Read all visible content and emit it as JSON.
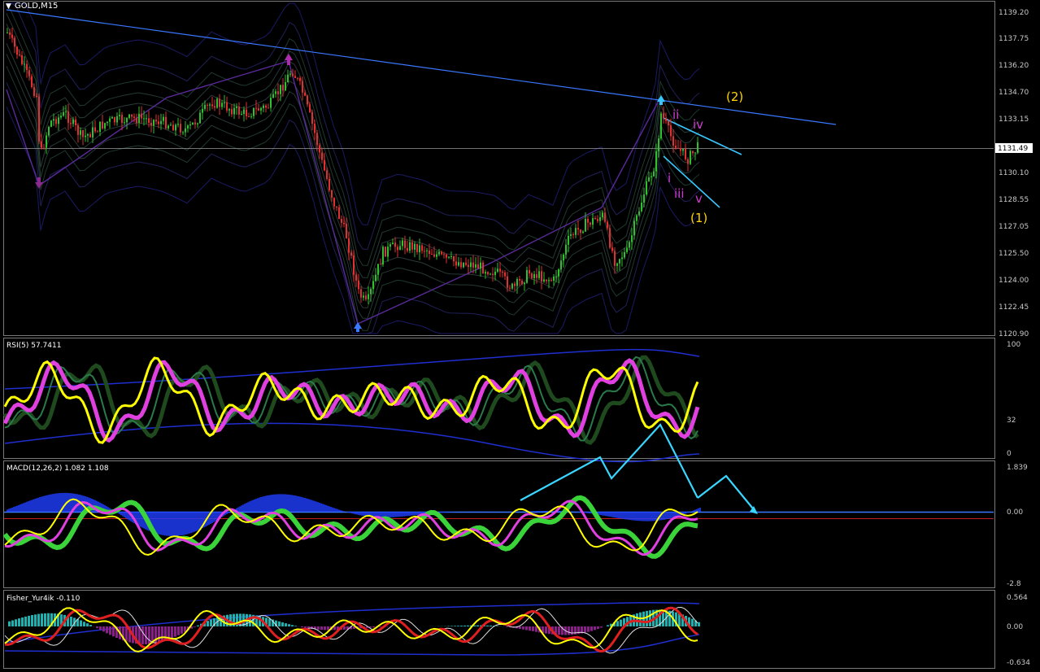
{
  "window": {
    "title": "GOLD,M15",
    "menu_glyph": "▼"
  },
  "colors": {
    "background": "#000000",
    "grid": "#2a2a2a",
    "axis_text": "#c8c8c8",
    "bull": "#2fbf2f",
    "bear": "#e03030",
    "trend": "#3a78ff",
    "channel": "#39c6ff",
    "wave_major": "#ffd400",
    "wave_minor": "#d23bd2",
    "rsi": "#ffff00",
    "rsi_glow": "#e040e0",
    "macd_line": "#ffff00",
    "macd_signal": "#e040e0",
    "macd_hist": "#1f3fff",
    "fisher_hist_pos": "#1fb0b0",
    "fisher_hist_neg": "#8a1f8a",
    "price_tag_bg": "#ffffff"
  },
  "main_panel": {
    "price_axis": [
      "1139.20",
      "1137.75",
      "1136.20",
      "1134.70",
      "1133.15",
      "1131.49",
      "1130.10",
      "1128.55",
      "1127.05",
      "1125.50",
      "1124.00",
      "1122.45",
      "1120.90"
    ],
    "current_price": "1131.49",
    "wave_labels": {
      "major_1": "(1)",
      "major_2": "(2)",
      "minor_i": "i",
      "minor_ii": "ii",
      "minor_iii": "iii",
      "minor_iv": "iv",
      "minor_v": "v"
    }
  },
  "rsi_panel": {
    "label": "RSI(5) 57.7411",
    "axis": [
      "100",
      "32",
      "0"
    ]
  },
  "macd_panel": {
    "label": "MACD(12,26,2) 1.082 1.108",
    "axis": [
      "1.839",
      "0.00",
      "-2.8"
    ]
  },
  "fisher_panel": {
    "label": "Fisher_Yur4ik -0.110",
    "axis": [
      "0.564",
      "0.00",
      "-0.634"
    ]
  }
}
